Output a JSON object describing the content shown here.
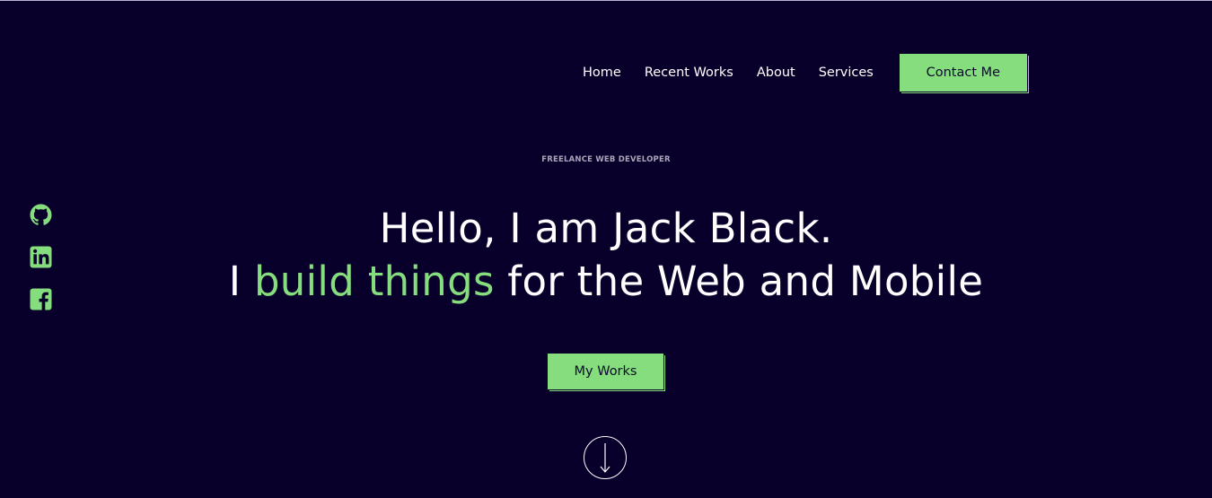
{
  "nav": {
    "items": [
      {
        "label": "Home"
      },
      {
        "label": "Recent Works"
      },
      {
        "label": "About"
      },
      {
        "label": "Services"
      }
    ],
    "contact_label": "Contact Me"
  },
  "hero": {
    "eyebrow": "FREELANCE WEB DEVELOPER",
    "line1": "Hello, I am Jack Black.",
    "line2_prefix": "I ",
    "line2_accent": "build things",
    "line2_suffix": " for the Web and Mobile",
    "cta_label": "My Works"
  },
  "social": {
    "icons": [
      "github-icon",
      "linkedin-icon",
      "facebook-icon"
    ]
  },
  "colors": {
    "background": "#08002a",
    "accent": "#86dd7e",
    "text": "#ffffff",
    "muted": "#a8a6b8"
  }
}
